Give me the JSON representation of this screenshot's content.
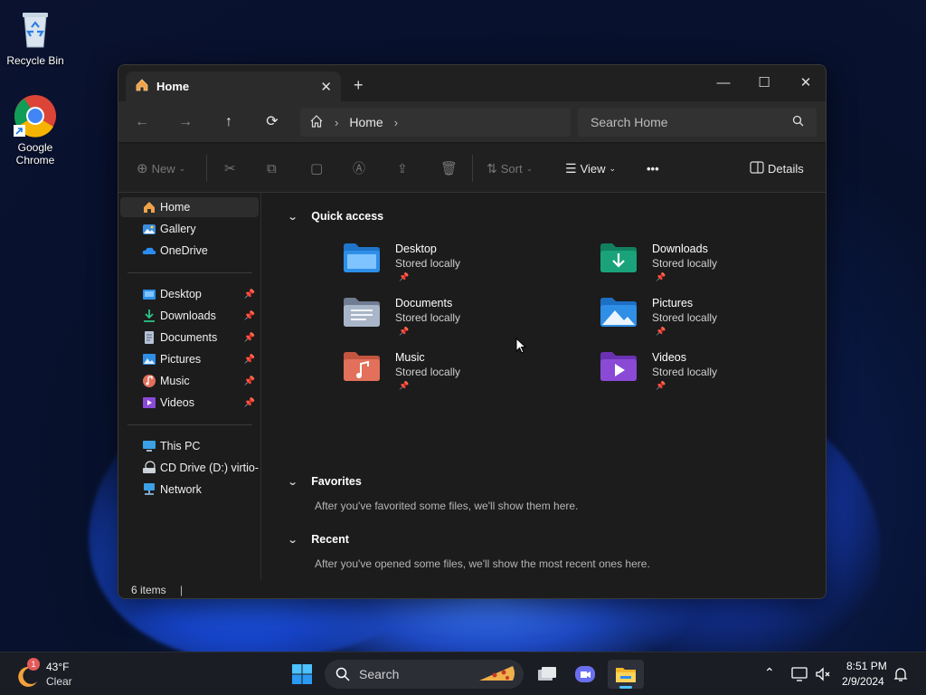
{
  "desktop": {
    "icons": [
      {
        "label": "Recycle Bin",
        "icon": "recycle-bin-icon"
      },
      {
        "label": "Google Chrome",
        "icon": "chrome-icon"
      }
    ]
  },
  "window": {
    "tab_title": "Home",
    "new_tab": "+",
    "controls": {
      "minimize": "—",
      "maximize": "☐",
      "close": "✕"
    },
    "nav": {
      "back": "←",
      "forward": "→",
      "up": "↑",
      "refresh": "⟳"
    },
    "address": {
      "crumb": "Home"
    },
    "search_placeholder": "Search Home",
    "toolbar": {
      "new_label": "New",
      "sort_label": "Sort",
      "view_label": "View",
      "more_label": "•••",
      "details_label": "Details"
    },
    "sidebar": {
      "top": [
        {
          "label": "Home",
          "icon": "home-icon",
          "selected": true
        },
        {
          "label": "Gallery",
          "icon": "gallery-icon"
        },
        {
          "label": "OneDrive",
          "icon": "onedrive-icon"
        }
      ],
      "pinned": [
        {
          "label": "Desktop",
          "icon": "desktop-folder-icon"
        },
        {
          "label": "Downloads",
          "icon": "downloads-icon"
        },
        {
          "label": "Documents",
          "icon": "documents-icon"
        },
        {
          "label": "Pictures",
          "icon": "pictures-icon"
        },
        {
          "label": "Music",
          "icon": "music-icon"
        },
        {
          "label": "Videos",
          "icon": "videos-icon"
        }
      ],
      "drives": [
        {
          "label": "This PC",
          "icon": "this-pc-icon"
        },
        {
          "label": "CD Drive (D:) virtio-w",
          "icon": "cd-drive-icon"
        },
        {
          "label": "Network",
          "icon": "network-icon"
        }
      ]
    },
    "quick_access": {
      "title": "Quick access",
      "items": [
        {
          "name": "Desktop",
          "sub": "Stored locally",
          "color": "#2e8fe8"
        },
        {
          "name": "Downloads",
          "sub": "Stored locally",
          "color": "#1aa37a"
        },
        {
          "name": "Documents",
          "sub": "Stored locally",
          "color": "#8c9ab0"
        },
        {
          "name": "Pictures",
          "sub": "Stored locally",
          "color": "#2f8ee6"
        },
        {
          "name": "Music",
          "sub": "Stored locally",
          "color": "#e2705a"
        },
        {
          "name": "Videos",
          "sub": "Stored locally",
          "color": "#8a4ad6"
        }
      ]
    },
    "favorites": {
      "title": "Favorites",
      "message": "After you've favorited some files, we'll show them here."
    },
    "recent": {
      "title": "Recent",
      "message": "After you've opened some files, we'll show the most recent ones here."
    },
    "status": "6 items"
  },
  "taskbar": {
    "weather": {
      "temp": "43°F",
      "condition": "Clear",
      "badge": "1"
    },
    "search_label": "Search",
    "time": "8:51 PM",
    "date": "2/9/2024"
  }
}
